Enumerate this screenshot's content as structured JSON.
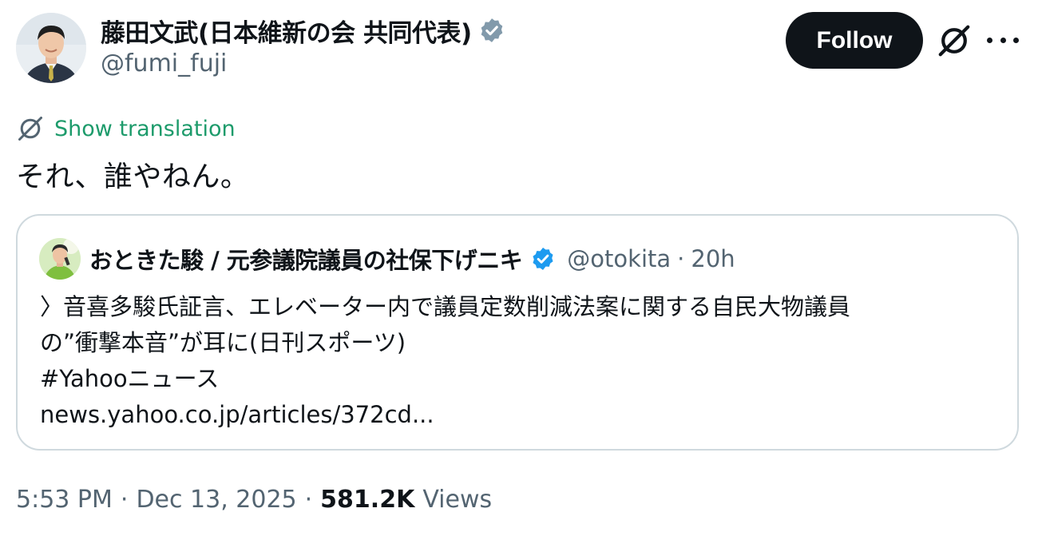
{
  "author": {
    "name": "藤田文武(日本維新の会 共同代表)",
    "handle": "@fumi_fuji",
    "verified_color": "#829aab"
  },
  "actions": {
    "follow_label": "Follow",
    "grok_icon": "grok-icon",
    "more_icon": "more-icon"
  },
  "translation": {
    "label": "Show translation",
    "color": "#1d9b6b"
  },
  "tweet": {
    "text": "それ、誰やねん。"
  },
  "quote": {
    "name": "おときた駿 / 元参議院議員の社保下げニキ",
    "handle": "@otokita",
    "dot": "·",
    "time": "20h",
    "verified_color": "#1d9bf0",
    "lines": [
      "〉音喜多駿氏証言、エレベーター内で議員定数削減法案に関する自民大物議員",
      "の”衝撃本音”が耳に(日刊スポーツ)",
      "#Yahooニュース",
      "news.yahoo.co.jp/articles/372cd..."
    ]
  },
  "meta": {
    "time": "5:53 PM",
    "sep1": "·",
    "date": "Dec 13, 2025",
    "sep2": "·",
    "views_count": "581.2K",
    "views_label": "Views"
  },
  "colors": {
    "text_primary": "#0f1419",
    "text_secondary": "#536471",
    "border": "#cfd9de",
    "follow_bg": "#0f1419"
  }
}
